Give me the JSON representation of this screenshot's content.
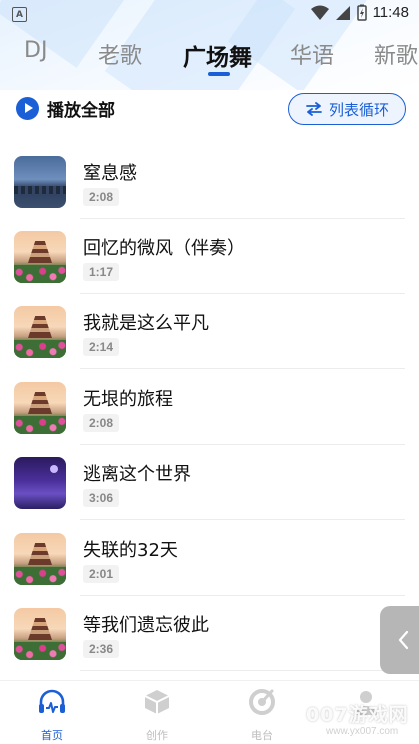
{
  "status_bar": {
    "time": "11:48",
    "app_badge": "A"
  },
  "tabs": [
    {
      "label": "DJ",
      "active": false
    },
    {
      "label": "老歌",
      "active": false
    },
    {
      "label": "广场舞",
      "active": true
    },
    {
      "label": "华语",
      "active": false
    },
    {
      "label": "新歌",
      "active": false
    }
  ],
  "toolbar": {
    "play_all_label": "播放全部",
    "loop_mode_label": "列表循环"
  },
  "songs": [
    {
      "title": "窒息感",
      "duration": "2:08",
      "thumb": "city"
    },
    {
      "title": "回忆的微风（伴奏）",
      "duration": "1:17",
      "thumb": "pagoda"
    },
    {
      "title": "我就是这么平凡",
      "duration": "2:14",
      "thumb": "pagoda"
    },
    {
      "title": "无垠的旅程",
      "duration": "2:08",
      "thumb": "pagoda"
    },
    {
      "title": "逃离这个世界",
      "duration": "3:06",
      "thumb": "purple"
    },
    {
      "title": "失联的32天",
      "duration": "2:01",
      "thumb": "pagoda"
    },
    {
      "title": "等我们遗忘彼此",
      "duration": "2:36",
      "thumb": "pagoda"
    }
  ],
  "bottom_nav": [
    {
      "label": "首页",
      "icon": "headphone-wave-icon",
      "active": true
    },
    {
      "label": "创作",
      "icon": "cube-icon",
      "active": false
    },
    {
      "label": "电台",
      "icon": "radio-dial-icon",
      "active": false
    },
    {
      "label": "",
      "icon": "profile-icon",
      "active": false
    }
  ],
  "watermark": {
    "brand": "007游戏网",
    "url": "www.yx007.com"
  },
  "colors": {
    "accent": "#1a5fd6",
    "inactive": "#bdbdbd"
  }
}
